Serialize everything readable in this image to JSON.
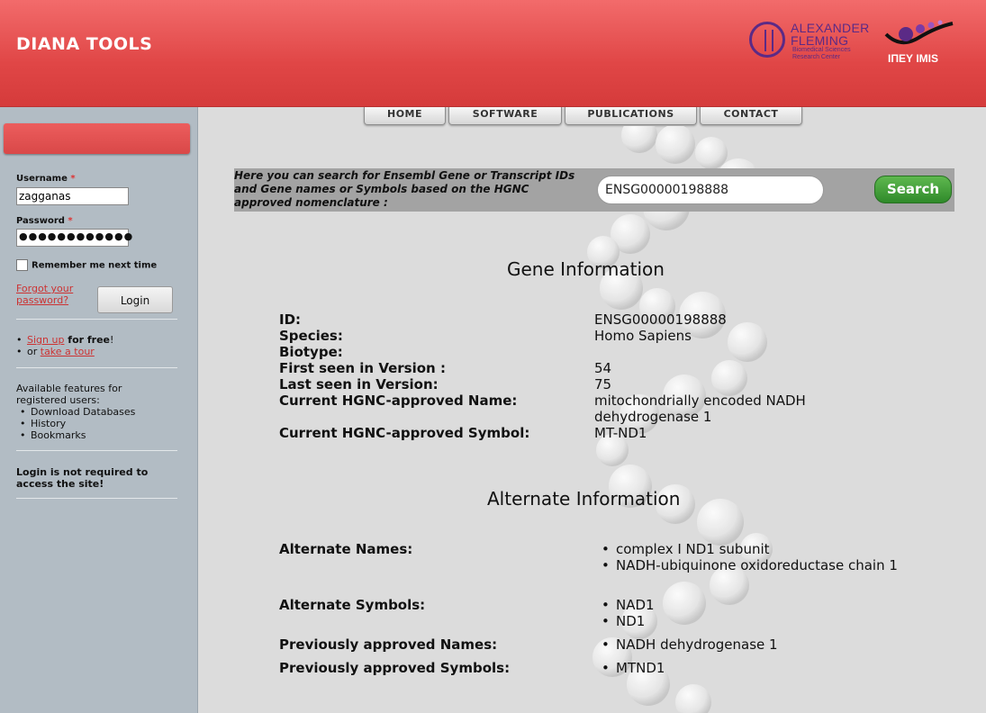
{
  "header": {
    "site_title": "DIANA TOOLS",
    "logo_fleming_line1": "ALEXANDER",
    "logo_fleming_line2": "FLEMING",
    "logo_fleming_sub1": "Biomedical Sciences",
    "logo_fleming_sub2": "Research Center",
    "logo_imis": "ΙΠΕΥ IMIS"
  },
  "nav": {
    "items": [
      {
        "label": "HOME"
      },
      {
        "label": "SOFTWARE"
      },
      {
        "label": "PUBLICATIONS"
      },
      {
        "label": "CONTACT"
      }
    ]
  },
  "sidebar": {
    "username_label": "Username",
    "username_value": "zagganas",
    "password_label": "Password",
    "password_value": "●●●●●●●●●●●●",
    "required_marker": "*",
    "remember_label": "Remember me next time",
    "forgot_link": "Forgot your password?",
    "login_button": "Login",
    "signup_link": "Sign up",
    "signup_suffix": " for free",
    "signup_bang": "!",
    "or_text": "or ",
    "tour_link": "take a tour",
    "features_intro": "Available features for registered users:",
    "features": [
      "Download Databases",
      "History",
      "Bookmarks"
    ],
    "not_required": "Login is not required to access the site!"
  },
  "search": {
    "description": "Here you can search for Ensembl Gene or Transcript IDs and Gene names or Symbols based on the HGNC approved nomenclature :",
    "value": "ENSG00000198888",
    "button": "Search"
  },
  "gene_info": {
    "title": "Gene Information",
    "rows": [
      {
        "label": "ID:",
        "value": "ENSG00000198888"
      },
      {
        "label": "Species:",
        "value": "Homo Sapiens"
      },
      {
        "label": "Biotype:",
        "value": ""
      },
      {
        "label": "First seen in Version :",
        "value": "54"
      },
      {
        "label": "Last seen in Version:",
        "value": "75"
      },
      {
        "label": "Current HGNC-approved Name:",
        "value": "mitochondrially encoded NADH dehydrogenase 1"
      },
      {
        "label": "Current HGNC-approved Symbol:",
        "value": "MT-ND1"
      }
    ]
  },
  "alt_info": {
    "title": "Alternate Information",
    "alt_names_label": "Alternate Names:",
    "alt_names": [
      "complex I ND1 subunit",
      "NADH-ubiquinone oxidoreductase chain 1"
    ],
    "alt_symbols_label": "Alternate Symbols:",
    "alt_symbols": [
      "NAD1",
      "ND1"
    ],
    "prev_names_label": "Previously approved Names:",
    "prev_names": [
      "NADH dehydrogenase 1"
    ],
    "prev_symbols_label": "Previously approved Symbols:",
    "prev_symbols": [
      "MTND1"
    ]
  }
}
